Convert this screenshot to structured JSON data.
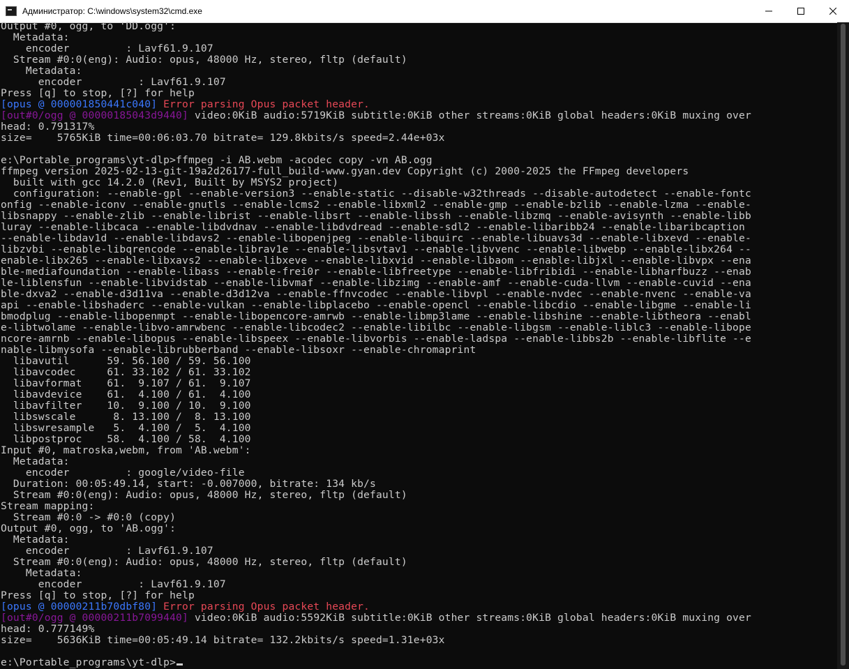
{
  "window": {
    "title": "Администратор: C:\\windows\\system32\\cmd.exe",
    "minimize_label": "",
    "maximize_label": "",
    "close_label": ""
  },
  "console": {
    "lines": [
      {
        "text": "Output #0, ogg, to 'DD.ogg':"
      },
      {
        "text": "  Metadata:"
      },
      {
        "text": "    encoder         : Lavf61.9.107"
      },
      {
        "text": "  Stream #0:0(eng): Audio: opus, 48000 Hz, stereo, fltp (default)"
      },
      {
        "text": "    Metadata:"
      },
      {
        "text": "      encoder         : Lavf61.9.107"
      },
      {
        "text": "Press [q] to stop, [?] for help"
      },
      {
        "tag": "[opus @ 000001850441c040]",
        "tag_style": "tag",
        "err": " Error parsing Opus packet header."
      },
      {
        "tag": "[out#0/ogg @ 00000185043d9440]",
        "tag_style": "tag-mux",
        "text": " video:0KiB audio:5719KiB subtitle:0KiB other streams:0KiB global headers:0KiB muxing over"
      },
      {
        "text": "head: 0.791317%"
      },
      {
        "text": "size=    5765KiB time=00:06:03.70 bitrate= 129.8kbits/s speed=2.44e+03x"
      },
      {
        "text": ""
      },
      {
        "text": "e:\\Portable_programs\\yt-dlp>ffmpeg -i AB.webm -acodec copy -vn AB.ogg"
      },
      {
        "text": "ffmpeg version 2025-02-13-git-19a2d26177-full_build-www.gyan.dev Copyright (c) 2000-2025 the FFmpeg developers"
      },
      {
        "text": "  built with gcc 14.2.0 (Rev1, Built by MSYS2 project)"
      },
      {
        "text": "  configuration: --enable-gpl --enable-version3 --enable-static --disable-w32threads --disable-autodetect --enable-fontc"
      },
      {
        "text": "onfig --enable-iconv --enable-gnutls --enable-lcms2 --enable-libxml2 --enable-gmp --enable-bzlib --enable-lzma --enable-"
      },
      {
        "text": "libsnappy --enable-zlib --enable-librist --enable-libsrt --enable-libssh --enable-libzmq --enable-avisynth --enable-libb"
      },
      {
        "text": "luray --enable-libcaca --enable-libdvdnav --enable-libdvdread --enable-sdl2 --enable-libaribb24 --enable-libaribcaption "
      },
      {
        "text": "--enable-libdav1d --enable-libdavs2 --enable-libopenjpeg --enable-libquirc --enable-libuavs3d --enable-libxevd --enable-"
      },
      {
        "text": "libzvbi --enable-libqrencode --enable-librav1e --enable-libsvtav1 --enable-libvvenc --enable-libwebp --enable-libx264 --"
      },
      {
        "text": "enable-libx265 --enable-libxavs2 --enable-libxeve --enable-libxvid --enable-libaom --enable-libjxl --enable-libvpx --ena"
      },
      {
        "text": "ble-mediafoundation --enable-libass --enable-frei0r --enable-libfreetype --enable-libfribidi --enable-libharfbuzz --enab"
      },
      {
        "text": "le-liblensfun --enable-libvidstab --enable-libvmaf --enable-libzimg --enable-amf --enable-cuda-llvm --enable-cuvid --ena"
      },
      {
        "text": "ble-dxva2 --enable-d3d11va --enable-d3d12va --enable-ffnvcodec --enable-libvpl --enable-nvdec --enable-nvenc --enable-va"
      },
      {
        "text": "api --enable-libshaderc --enable-vulkan --enable-libplacebo --enable-opencl --enable-libcdio --enable-libgme --enable-li"
      },
      {
        "text": "bmodplug --enable-libopenmpt --enable-libopencore-amrwb --enable-libmp3lame --enable-libshine --enable-libtheora --enabl"
      },
      {
        "text": "e-libtwolame --enable-libvo-amrwbenc --enable-libcodec2 --enable-libilbc --enable-libgsm --enable-liblc3 --enable-libope"
      },
      {
        "text": "ncore-amrnb --enable-libopus --enable-libspeex --enable-libvorbis --enable-ladspa --enable-libbs2b --enable-libflite --e"
      },
      {
        "text": "nable-libmysofa --enable-librubberband --enable-libsoxr --enable-chromaprint"
      },
      {
        "text": "  libavutil      59. 56.100 / 59. 56.100"
      },
      {
        "text": "  libavcodec     61. 33.102 / 61. 33.102"
      },
      {
        "text": "  libavformat    61.  9.107 / 61.  9.107"
      },
      {
        "text": "  libavdevice    61.  4.100 / 61.  4.100"
      },
      {
        "text": "  libavfilter    10.  9.100 / 10.  9.100"
      },
      {
        "text": "  libswscale      8. 13.100 /  8. 13.100"
      },
      {
        "text": "  libswresample   5.  4.100 /  5.  4.100"
      },
      {
        "text": "  libpostproc    58.  4.100 / 58.  4.100"
      },
      {
        "text": "Input #0, matroska,webm, from 'AB.webm':"
      },
      {
        "text": "  Metadata:"
      },
      {
        "text": "    encoder         : google/video-file"
      },
      {
        "text": "  Duration: 00:05:49.14, start: -0.007000, bitrate: 134 kb/s"
      },
      {
        "text": "  Stream #0:0(eng): Audio: opus, 48000 Hz, stereo, fltp (default)"
      },
      {
        "text": "Stream mapping:"
      },
      {
        "text": "  Stream #0:0 -> #0:0 (copy)"
      },
      {
        "text": "Output #0, ogg, to 'AB.ogg':"
      },
      {
        "text": "  Metadata:"
      },
      {
        "text": "    encoder         : Lavf61.9.107"
      },
      {
        "text": "  Stream #0:0(eng): Audio: opus, 48000 Hz, stereo, fltp (default)"
      },
      {
        "text": "    Metadata:"
      },
      {
        "text": "      encoder         : Lavf61.9.107"
      },
      {
        "text": "Press [q] to stop, [?] for help"
      },
      {
        "tag": "[opus @ 00000211b70dbf80]",
        "tag_style": "tag",
        "err": " Error parsing Opus packet header."
      },
      {
        "tag": "[out#0/ogg @ 00000211b7099440]",
        "tag_style": "tag-mux",
        "text": " video:0KiB audio:5592KiB subtitle:0KiB other streams:0KiB global headers:0KiB muxing over"
      },
      {
        "text": "head: 0.777149%"
      },
      {
        "text": "size=    5636KiB time=00:05:49.14 bitrate= 132.2kbits/s speed=1.31e+03x"
      },
      {
        "text": ""
      },
      {
        "text": "e:\\Portable_programs\\yt-dlp>",
        "prompt": true
      }
    ]
  },
  "colors": {
    "background": "#0c0c0c",
    "foreground": "#cccccc",
    "tag_blue": "#3b78ff",
    "tag_purple": "#881798",
    "error_red": "#e74856"
  },
  "icons": {
    "app": "cmd-icon",
    "minimize": "minimize-icon",
    "maximize": "maximize-icon",
    "close": "close-icon"
  }
}
